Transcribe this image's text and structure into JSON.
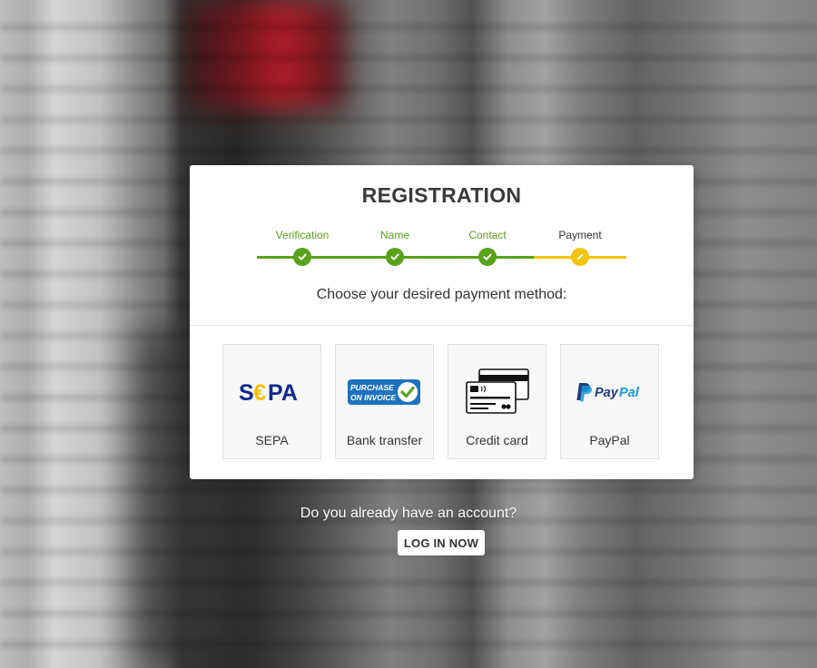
{
  "registration": {
    "title": "REGISTRATION",
    "steps": [
      {
        "label": "Verification",
        "status": "done"
      },
      {
        "label": "Name",
        "status": "done"
      },
      {
        "label": "Contact",
        "status": "done"
      },
      {
        "label": "Payment",
        "status": "current"
      }
    ],
    "prompt": "Choose your desired payment method:",
    "methods": [
      {
        "name": "SEPA",
        "icon": "sepa-logo"
      },
      {
        "name": "Bank transfer",
        "icon": "purchase-on-invoice-logo",
        "logo_text_1": "PURCHASE",
        "logo_text_2": "ON INVOICE"
      },
      {
        "name": "Credit card",
        "icon": "credit-card-icon"
      },
      {
        "name": "PayPal",
        "icon": "paypal-logo"
      }
    ]
  },
  "account": {
    "question": "Do you already have an account?",
    "login_label": "LOG IN NOW"
  },
  "colors": {
    "done": "#5aa21a",
    "current": "#f2c40c",
    "sepa_blue": "#10298e",
    "sepa_yellow": "#ffbe00",
    "paypal_dark": "#253b80",
    "paypal_light": "#179bd7",
    "invoice_blue": "#1e73be"
  }
}
